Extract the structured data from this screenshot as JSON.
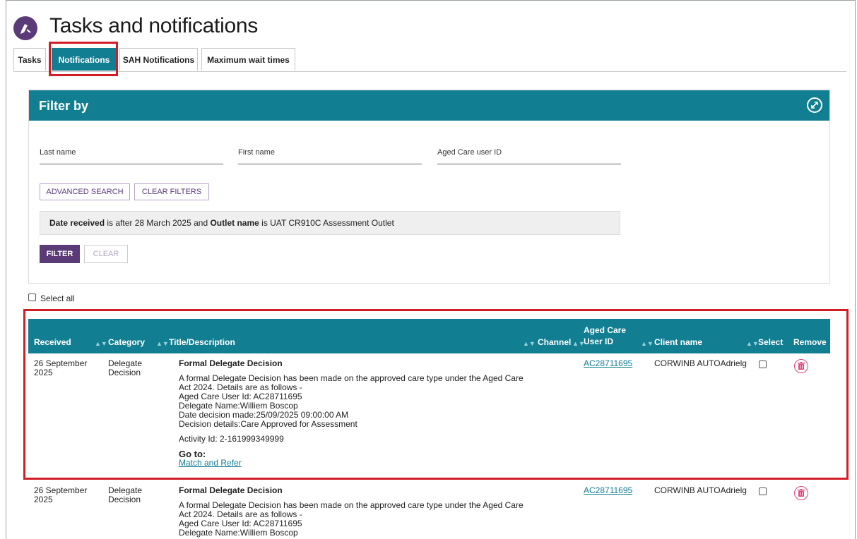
{
  "header": {
    "title": "Tasks and notifications",
    "icon": "tasks-icon"
  },
  "tabs": [
    {
      "label": "Tasks",
      "active": false
    },
    {
      "label": "Notifications",
      "active": true
    },
    {
      "label": "SAH Notifications",
      "active": false
    },
    {
      "label": "Maximum wait times",
      "active": false
    }
  ],
  "filter": {
    "title": "Filter by",
    "collapse_icon": "collapse-arrows-icon",
    "fields": {
      "last_name": {
        "label": "Last name",
        "value": ""
      },
      "first_name": {
        "label": "First name",
        "value": ""
      },
      "user_id": {
        "label": "Aged Care user ID",
        "value": ""
      }
    },
    "advanced_search_label": "ADVANCED SEARCH",
    "clear_filters_label": "CLEAR FILTERS",
    "summary": {
      "part1_bold": "Date received",
      "part2": " is after 28 March 2025 and ",
      "part3_bold": "Outlet name",
      "part4": " is UAT CR910C Assessment Outlet"
    },
    "filter_label": "FILTER",
    "clear_label": "CLEAR"
  },
  "select_all_label": "Select all",
  "table": {
    "headers": {
      "received": "Received",
      "category": "Category",
      "title": "Title/Description",
      "channel": "Channel",
      "user_id_line1": "Aged Care",
      "user_id_line2": "User ID",
      "client": "Client name",
      "select": "Select",
      "remove": "Remove"
    },
    "rows": [
      {
        "received_line1": "26 September",
        "received_line2": "2025",
        "category_line1": "Delegate",
        "category_line2": "Decision",
        "title": "Formal Delegate Decision",
        "desc_lines": [
          "A formal Delegate Decision has been made on the approved care type under the Aged Care",
          "Act 2024. Details are as follows -",
          "Aged Care User Id: AC28711695",
          "Delegate Name:Williem Boscop",
          "Date decision made:25/09/2025 09:00:00 AM",
          "Decision details:Care Approved for Assessment"
        ],
        "activity": "Activity Id: 2-161999349999",
        "goto_label": "Go to:",
        "goto_link": "Match and Refer",
        "user_id": "AC28711695",
        "client": "CORWINB AUTOAdrielg"
      },
      {
        "received_line1": "26 September",
        "received_line2": "2025",
        "category_line1": "Delegate",
        "category_line2": "Decision",
        "title": "Formal Delegate Decision",
        "desc_lines": [
          "A formal Delegate Decision has been made on the approved care type under the Aged Care",
          "Act 2024. Details are as follows -",
          "Aged Care User Id: AC28711695",
          "Delegate Name:Williem Boscop"
        ],
        "user_id": "AC28711695",
        "client": "CORWINB AUTOAdrielg"
      }
    ]
  },
  "colors": {
    "teal": "#127e92",
    "purple": "#5b3a78",
    "highlight_red": "#d11e26",
    "remove_pink": "#e0457b"
  }
}
